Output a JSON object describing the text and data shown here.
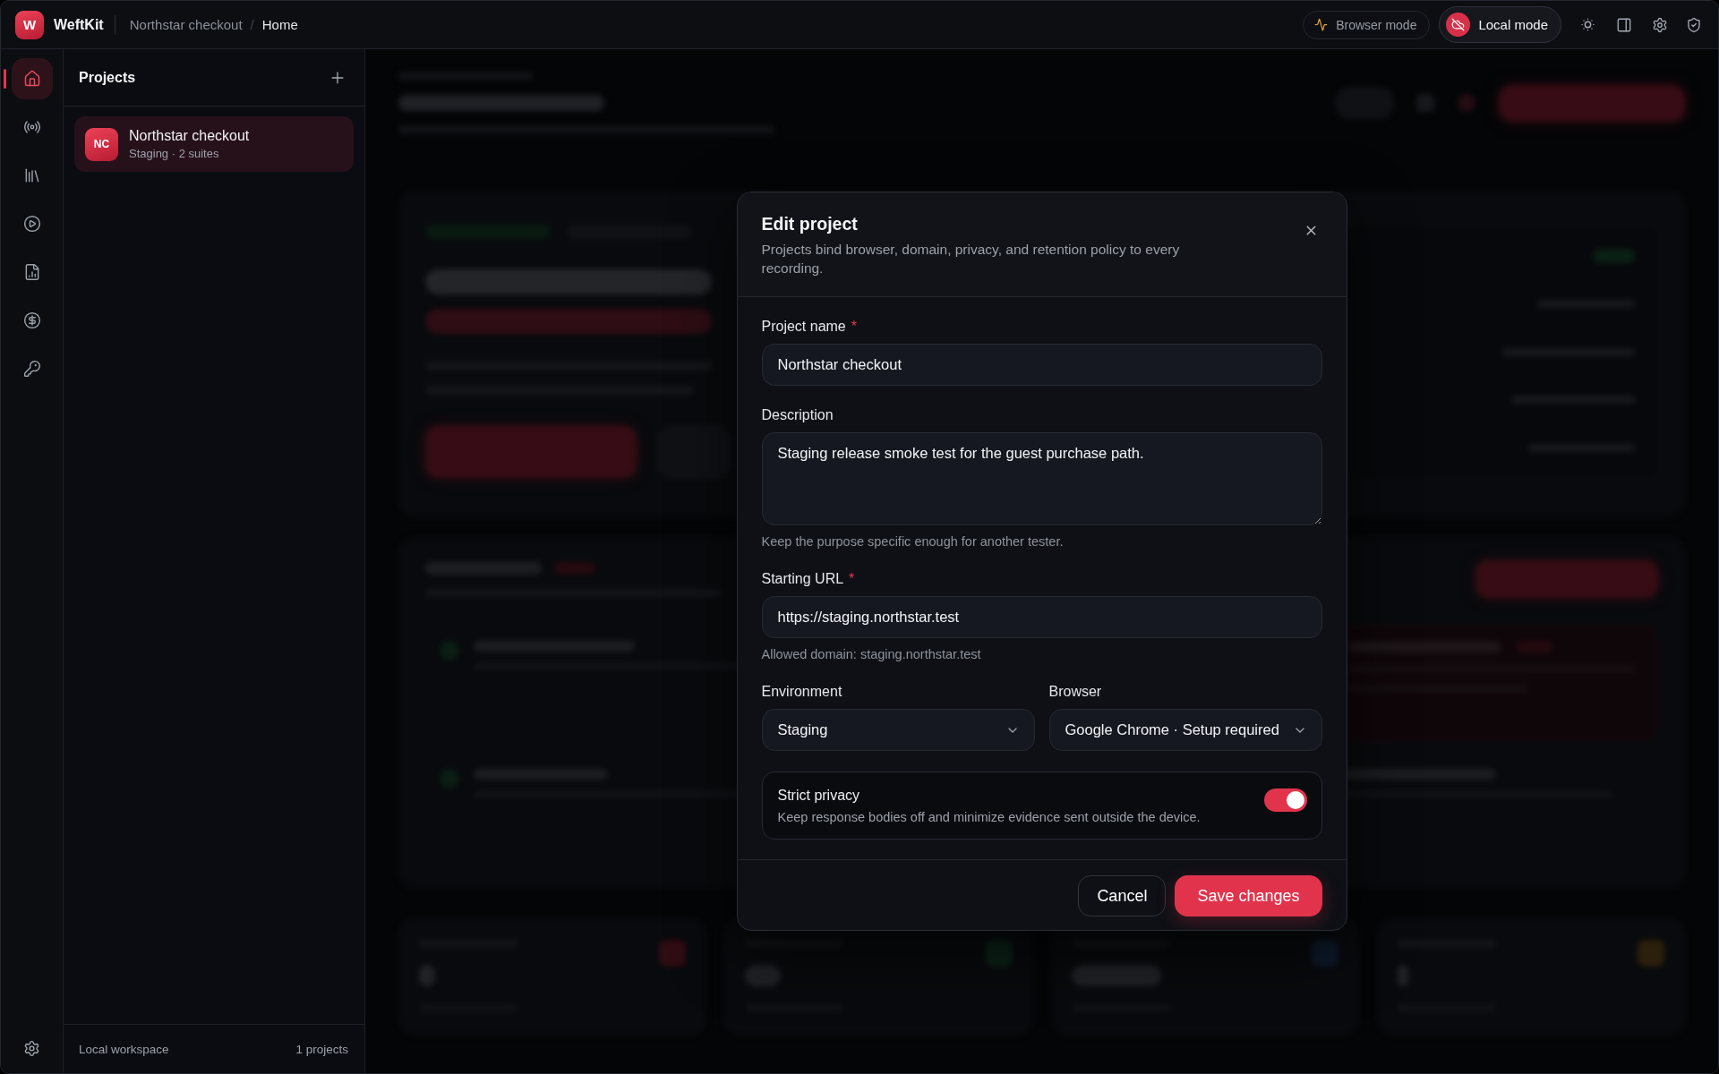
{
  "app": {
    "logo_letter": "W",
    "name": "WeftKit"
  },
  "breadcrumb": {
    "separator": "/",
    "items": [
      {
        "label": "Northstar checkout",
        "current": false
      },
      {
        "label": "Home",
        "current": true
      }
    ]
  },
  "top_bar": {
    "modes": [
      {
        "kind": "browser",
        "label": "Browser mode",
        "selected": false
      },
      {
        "kind": "local",
        "label": "Local mode",
        "selected": true
      }
    ]
  },
  "rail": {
    "items": [
      {
        "selected": true
      },
      {
        "selected": false
      },
      {
        "selected": false
      },
      {
        "selected": false
      },
      {
        "selected": false
      },
      {
        "selected": false
      },
      {
        "selected": false
      }
    ]
  },
  "projects_panel": {
    "title": "Projects",
    "projects": [
      {
        "initials": "NC",
        "name": "Northstar checkout",
        "meta": "Staging · 2 suites",
        "selected": true
      }
    ],
    "footer": {
      "workspace": "Local workspace",
      "count": "1 projects"
    }
  },
  "dialog": {
    "title": "Edit project",
    "description": "Projects bind browser, domain, privacy, and retention policy to every recording.",
    "fields": [
      {
        "kind": "text",
        "label": "Project name",
        "required_mark": "*",
        "value": "Northstar checkout"
      },
      {
        "kind": "textarea",
        "label": "Description",
        "value": "Staging release smoke test for the guest purchase path.",
        "hint": "Keep the purpose specific enough for another tester."
      },
      {
        "kind": "text",
        "label": "Starting URL",
        "required_mark": "*",
        "value": "https://staging.northstar.test",
        "hint": "Allowed domain: staging.northstar.test"
      }
    ],
    "selects": [
      {
        "label": "Environment",
        "value": "Staging"
      },
      {
        "label": "Browser",
        "value": "Google Chrome · Setup required"
      }
    ],
    "privacy": {
      "title": "Strict privacy",
      "description": "Keep response bodies off and minimize evidence sent outside the device.",
      "on": true
    },
    "buttons": [
      {
        "kind": "secondary",
        "label": "Cancel"
      },
      {
        "kind": "primary",
        "label": "Save changes"
      }
    ]
  }
}
